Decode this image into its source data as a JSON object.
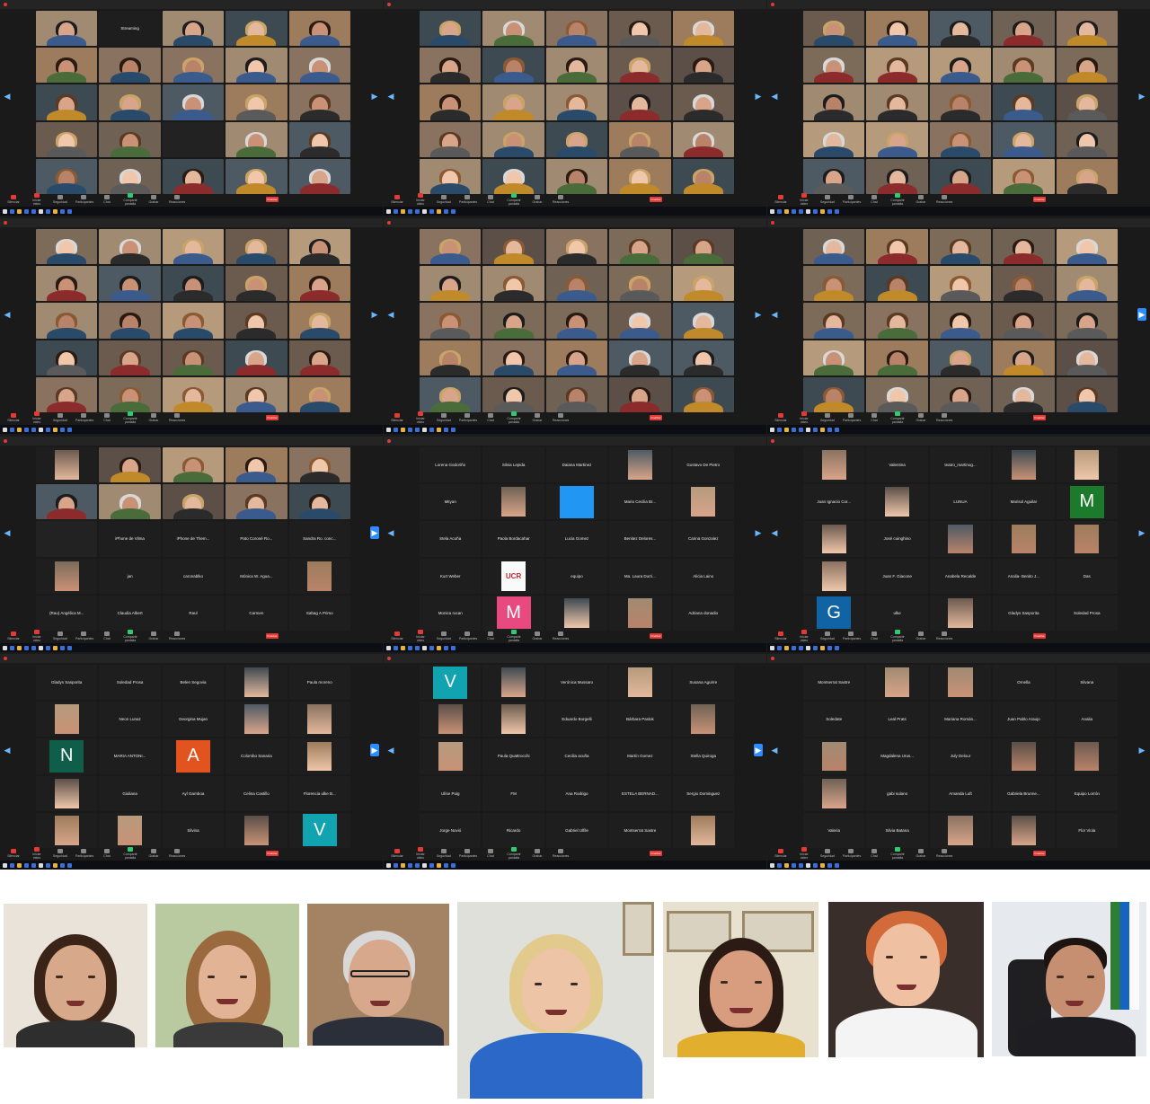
{
  "app": {
    "name": "Zoom"
  },
  "toolbar_labels": [
    "Silenciar",
    "Iniciar video",
    "Seguridad",
    "Participantes",
    "Chat",
    "Compartir pantalla",
    "Grabar",
    "Reacciones",
    "Finalizar"
  ],
  "screens": [
    {
      "tiles": [
        {
          "t": "vid"
        },
        {
          "t": "name",
          "n": "Streaming"
        },
        {
          "t": "vid"
        },
        {
          "t": "vid"
        },
        {
          "t": "vid"
        },
        {
          "t": "vid"
        },
        {
          "t": "vid"
        },
        {
          "t": "vid"
        },
        {
          "t": "vid"
        },
        {
          "t": "vid"
        },
        {
          "t": "vid"
        },
        {
          "t": "vid"
        },
        {
          "t": "vid"
        },
        {
          "t": "vid"
        },
        {
          "t": "vid"
        },
        {
          "t": "vid"
        },
        {
          "t": "vid"
        },
        {
          "t": "blank"
        },
        {
          "t": "vid"
        },
        {
          "t": "vid"
        },
        {
          "t": "vid"
        },
        {
          "t": "vid"
        },
        {
          "t": "vid"
        },
        {
          "t": "vid"
        },
        {
          "t": "vid"
        }
      ]
    },
    {
      "tiles": [
        {
          "t": "vid"
        },
        {
          "t": "vid"
        },
        {
          "t": "vid"
        },
        {
          "t": "vid"
        },
        {
          "t": "vid"
        },
        {
          "t": "vid"
        },
        {
          "t": "vid"
        },
        {
          "t": "vid"
        },
        {
          "t": "vid"
        },
        {
          "t": "vid"
        },
        {
          "t": "vid"
        },
        {
          "t": "vid"
        },
        {
          "t": "vid"
        },
        {
          "t": "vid"
        },
        {
          "t": "vid"
        },
        {
          "t": "vid"
        },
        {
          "t": "vid"
        },
        {
          "t": "vid"
        },
        {
          "t": "vid"
        },
        {
          "t": "vid"
        },
        {
          "t": "vid"
        },
        {
          "t": "vid"
        },
        {
          "t": "vid"
        },
        {
          "t": "vid"
        },
        {
          "t": "vid"
        }
      ]
    },
    {
      "tiles": [
        {
          "t": "vid"
        },
        {
          "t": "vid"
        },
        {
          "t": "vid"
        },
        {
          "t": "vid"
        },
        {
          "t": "vid"
        },
        {
          "t": "vid"
        },
        {
          "t": "vid"
        },
        {
          "t": "vid"
        },
        {
          "t": "vid"
        },
        {
          "t": "vid"
        },
        {
          "t": "vid"
        },
        {
          "t": "vid"
        },
        {
          "t": "vid"
        },
        {
          "t": "vid"
        },
        {
          "t": "vid"
        },
        {
          "t": "vid"
        },
        {
          "t": "vid"
        },
        {
          "t": "vid"
        },
        {
          "t": "vid"
        },
        {
          "t": "vid"
        },
        {
          "t": "vid"
        },
        {
          "t": "vid"
        },
        {
          "t": "vid"
        },
        {
          "t": "vid"
        },
        {
          "t": "vid"
        }
      ]
    },
    {
      "tiles": [
        {
          "t": "vid"
        },
        {
          "t": "vid"
        },
        {
          "t": "vid"
        },
        {
          "t": "vid"
        },
        {
          "t": "vid"
        },
        {
          "t": "vid"
        },
        {
          "t": "vid"
        },
        {
          "t": "vid"
        },
        {
          "t": "vid"
        },
        {
          "t": "vid"
        },
        {
          "t": "vid"
        },
        {
          "t": "vid"
        },
        {
          "t": "vid"
        },
        {
          "t": "vid"
        },
        {
          "t": "vid"
        },
        {
          "t": "vid"
        },
        {
          "t": "vid"
        },
        {
          "t": "vid"
        },
        {
          "t": "vid"
        },
        {
          "t": "vid"
        },
        {
          "t": "vid"
        },
        {
          "t": "vid"
        },
        {
          "t": "vid"
        },
        {
          "t": "vid"
        },
        {
          "t": "vid"
        }
      ]
    },
    {
      "tiles": [
        {
          "t": "vid"
        },
        {
          "t": "vid"
        },
        {
          "t": "vid"
        },
        {
          "t": "vid"
        },
        {
          "t": "vid"
        },
        {
          "t": "vid"
        },
        {
          "t": "vid"
        },
        {
          "t": "vid"
        },
        {
          "t": "vid"
        },
        {
          "t": "vid"
        },
        {
          "t": "vid"
        },
        {
          "t": "vid"
        },
        {
          "t": "vid"
        },
        {
          "t": "vid"
        },
        {
          "t": "vid"
        },
        {
          "t": "vid"
        },
        {
          "t": "vid"
        },
        {
          "t": "vid"
        },
        {
          "t": "vid"
        },
        {
          "t": "vid"
        },
        {
          "t": "vid"
        },
        {
          "t": "vid"
        },
        {
          "t": "vid"
        },
        {
          "t": "vid"
        },
        {
          "t": "vid"
        }
      ]
    },
    {
      "tiles": [
        {
          "t": "vid"
        },
        {
          "t": "vid"
        },
        {
          "t": "vid"
        },
        {
          "t": "vid"
        },
        {
          "t": "vid"
        },
        {
          "t": "vid"
        },
        {
          "t": "vid"
        },
        {
          "t": "vid"
        },
        {
          "t": "vid"
        },
        {
          "t": "vid"
        },
        {
          "t": "vid"
        },
        {
          "t": "vid"
        },
        {
          "t": "vid"
        },
        {
          "t": "vid"
        },
        {
          "t": "vid"
        },
        {
          "t": "vid"
        },
        {
          "t": "vid"
        },
        {
          "t": "vid"
        },
        {
          "t": "vid"
        },
        {
          "t": "vid"
        },
        {
          "t": "vid"
        },
        {
          "t": "vid"
        },
        {
          "t": "vid"
        },
        {
          "t": "vid"
        },
        {
          "t": "vid"
        }
      ]
    },
    {
      "tiles": [
        {
          "t": "smallpic"
        },
        {
          "t": "vid"
        },
        {
          "t": "vid"
        },
        {
          "t": "vid"
        },
        {
          "t": "vid"
        },
        {
          "t": "vid"
        },
        {
          "t": "vid"
        },
        {
          "t": "vid"
        },
        {
          "t": "vid"
        },
        {
          "t": "vid"
        },
        {
          "t": "blank"
        },
        {
          "t": "name",
          "n": "iPhone de Vilma"
        },
        {
          "t": "name",
          "n": "iPhone de Them..."
        },
        {
          "t": "name",
          "n": "Pato Coroné Ro..."
        },
        {
          "t": "name",
          "n": "Sandra Ro. conc..."
        },
        {
          "t": "smallpic"
        },
        {
          "t": "name",
          "n": "jan"
        },
        {
          "t": "name",
          "n": "caronablko"
        },
        {
          "t": "name",
          "n": "Mónica W. Agua..."
        },
        {
          "t": "smallpic"
        },
        {
          "t": "name",
          "n": "(Rau) Angélica M..."
        },
        {
          "t": "name",
          "n": "Claudia Albert"
        },
        {
          "t": "name",
          "n": "Raul"
        },
        {
          "t": "name",
          "n": "Carmen"
        },
        {
          "t": "name",
          "n": "Sabag A Primo"
        }
      ]
    },
    {
      "tiles": [
        {
          "t": "name",
          "n": "Lorena Godoriño"
        },
        {
          "t": "name",
          "n": "Silvia Lepida"
        },
        {
          "t": "name",
          "n": "Daiana Martinez"
        },
        {
          "t": "smallpic"
        },
        {
          "t": "name",
          "n": "Gustavo De Pietro"
        },
        {
          "t": "name",
          "n": "Mityan"
        },
        {
          "t": "smallpic"
        },
        {
          "t": "letterblank"
        },
        {
          "t": "name",
          "n": "Mario Cecilia Br..."
        },
        {
          "t": "smallpic"
        },
        {
          "t": "name",
          "n": "Stela Acuña"
        },
        {
          "t": "name",
          "n": "Paola Bordacahar"
        },
        {
          "t": "name",
          "n": "Lucia Gomez"
        },
        {
          "t": "name",
          "n": "Benitez Delores..."
        },
        {
          "t": "name",
          "n": "Carina Gonzalez"
        },
        {
          "t": "name",
          "n": "Kurt Weber"
        },
        {
          "t": "smallpic",
          "n": "UCR"
        },
        {
          "t": "name",
          "n": "equipo"
        },
        {
          "t": "name",
          "n": "Ma. Laura Durri..."
        },
        {
          "t": "name",
          "n": "Alicia Laino"
        },
        {
          "t": "name",
          "n": "Monica rucan"
        },
        {
          "t": "letter",
          "n": "M",
          "c": "#e84a7f"
        },
        {
          "t": "smallpic"
        },
        {
          "t": "smallpic"
        },
        {
          "t": "name",
          "n": "Adriana donadio"
        }
      ]
    },
    {
      "tiles": [
        {
          "t": "smallpic"
        },
        {
          "t": "name",
          "n": "Valentina"
        },
        {
          "t": "name",
          "n": "teatro_martinog..."
        },
        {
          "t": "smallpic"
        },
        {
          "t": "smallpic"
        },
        {
          "t": "name",
          "n": "Juan Ignacio Cor..."
        },
        {
          "t": "smallpic"
        },
        {
          "t": "name",
          "n": "LUNUA"
        },
        {
          "t": "name",
          "n": "Marisol Aguilar"
        },
        {
          "t": "letter",
          "n": "M",
          "c": "#1b7a2b"
        },
        {
          "t": "smallpic"
        },
        {
          "t": "name",
          "n": "José cuinghino"
        },
        {
          "t": "smallpic"
        },
        {
          "t": "smallpic"
        },
        {
          "t": "smallpic"
        },
        {
          "t": "smallpic"
        },
        {
          "t": "name",
          "n": "Juan F. Giacone"
        },
        {
          "t": "name",
          "n": "Anabela Recalde"
        },
        {
          "t": "name",
          "n": "Analia- Benito J..."
        },
        {
          "t": "name",
          "n": "Das"
        },
        {
          "t": "letter",
          "n": "G",
          "c": "#1064a3"
        },
        {
          "t": "name",
          "n": "ulke"
        },
        {
          "t": "smallpic"
        },
        {
          "t": "name",
          "n": "Gladys Sasporita"
        },
        {
          "t": "name",
          "n": "Soledad Prosa"
        }
      ]
    },
    {
      "tiles": [
        {
          "t": "name",
          "n": "Gladys Sasporita"
        },
        {
          "t": "name",
          "n": "Soledad Prosa"
        },
        {
          "t": "name",
          "n": "Belen Segovia"
        },
        {
          "t": "smallpic"
        },
        {
          "t": "name",
          "n": "Paula moreno"
        },
        {
          "t": "smallpic"
        },
        {
          "t": "name",
          "n": "Neon Lunaz"
        },
        {
          "t": "name",
          "n": "Georgina Mujan"
        },
        {
          "t": "smallpic"
        },
        {
          "t": "smallpic"
        },
        {
          "t": "letter",
          "n": "N",
          "c": "#0f5e4a"
        },
        {
          "t": "name",
          "n": "MARIA ANTONI..."
        },
        {
          "t": "letter",
          "n": "A",
          "c": "#e2531f"
        },
        {
          "t": "name",
          "n": "Colombo Sanaria"
        },
        {
          "t": "smallpic"
        },
        {
          "t": "smallpic"
        },
        {
          "t": "name",
          "n": "Giuliana"
        },
        {
          "t": "name",
          "n": "Ayl Gamboa"
        },
        {
          "t": "name",
          "n": "Celina Castillo"
        },
        {
          "t": "name",
          "n": "Florencia ulke B..."
        },
        {
          "t": "smallpic"
        },
        {
          "t": "smallpic"
        },
        {
          "t": "name",
          "n": "Silvina"
        },
        {
          "t": "smallpic"
        },
        {
          "t": "letter",
          "n": "V",
          "c": "#12a3b0"
        }
      ]
    },
    {
      "tiles": [
        {
          "t": "letter",
          "n": "V",
          "c": "#12a3b0"
        },
        {
          "t": "smallpic"
        },
        {
          "t": "name",
          "n": "Verónica Mussaro"
        },
        {
          "t": "smallpic"
        },
        {
          "t": "name",
          "n": "Susana Aguirre"
        },
        {
          "t": "smallpic"
        },
        {
          "t": "smallpic"
        },
        {
          "t": "name",
          "n": "Eduardo Borgelli"
        },
        {
          "t": "name",
          "n": "Bárbara Paslok"
        },
        {
          "t": "smallpic"
        },
        {
          "t": "smallpic"
        },
        {
          "t": "name",
          "n": "Paula Quattrocchi"
        },
        {
          "t": "name",
          "n": "Cecilia acuña"
        },
        {
          "t": "name",
          "n": "Martín Gomez"
        },
        {
          "t": "name",
          "n": "Stella Quiroga"
        },
        {
          "t": "name",
          "n": "Ulíse Puig"
        },
        {
          "t": "name",
          "n": "FM"
        },
        {
          "t": "name",
          "n": "Ana Rodrigo"
        },
        {
          "t": "name",
          "n": "ESTELA BERNAD..."
        },
        {
          "t": "name",
          "n": "Sergio Dominguez"
        },
        {
          "t": "name",
          "n": "Jorge Novió"
        },
        {
          "t": "name",
          "n": "Ricardo"
        },
        {
          "t": "name",
          "n": "Gabriel Ulfile"
        },
        {
          "t": "name",
          "n": "Montserrat Sastre"
        },
        {
          "t": "smallpic"
        }
      ]
    },
    {
      "tiles": [
        {
          "t": "name",
          "n": "Montserrat Sastre"
        },
        {
          "t": "smallpic"
        },
        {
          "t": "smallpic"
        },
        {
          "t": "name",
          "n": "Ornella"
        },
        {
          "t": "name",
          "n": "Silvana"
        },
        {
          "t": "name",
          "n": "Soledate"
        },
        {
          "t": "name",
          "n": "Leal Prats"
        },
        {
          "t": "name",
          "n": "Mariana Román..."
        },
        {
          "t": "name",
          "n": "Juan Pablo Araujo"
        },
        {
          "t": "name",
          "n": "Analia"
        },
        {
          "t": "smallpic"
        },
        {
          "t": "name",
          "n": "Magdalena Urus..."
        },
        {
          "t": "name",
          "n": "July Delour"
        },
        {
          "t": "smallpic"
        },
        {
          "t": "smallpic"
        },
        {
          "t": "smallpic"
        },
        {
          "t": "name",
          "n": "gabi sulano"
        },
        {
          "t": "name",
          "n": "Amanda Luft"
        },
        {
          "t": "name",
          "n": "Gabriela Brunne..."
        },
        {
          "t": "name",
          "n": "Equipo Lorrón"
        },
        {
          "t": "name",
          "n": "Valeria"
        },
        {
          "t": "name",
          "n": "Silvia Batana"
        },
        {
          "t": "smallpic"
        },
        {
          "t": "smallpic"
        },
        {
          "t": "name",
          "n": "Flor Viola"
        }
      ]
    }
  ],
  "speakers": [
    {
      "bg": "#e9e3d9",
      "skin": "#d8a88a",
      "hair": "#3a2418",
      "shirt": "#2e2e2e"
    },
    {
      "bg": "#b9c9a0",
      "skin": "#e2b394",
      "hair": "#9a6a3e",
      "shirt": "#3a3a3a"
    },
    {
      "bg": "#a48264",
      "skin": "#d7a88c",
      "hair": "#d8d8d8",
      "shirt": "#2a2f3a"
    },
    {
      "bg": "#dfe0da",
      "skin": "#edc4a6",
      "hair": "#e2c98c",
      "shirt": "#2b68c7"
    },
    {
      "bg": "#e8e1cf",
      "skin": "#d89d7e",
      "hair": "#2b1b14",
      "shirt": "#e1ae2d"
    },
    {
      "bg": "#3a2e2a",
      "skin": "#f0c0a2",
      "hair": "#d26a3a",
      "shirt": "#f4f4f4"
    },
    {
      "bg": "#e6e9ee",
      "skin": "#c78f72",
      "hair": "#1b1410",
      "shirt": "#1d1d22"
    }
  ]
}
